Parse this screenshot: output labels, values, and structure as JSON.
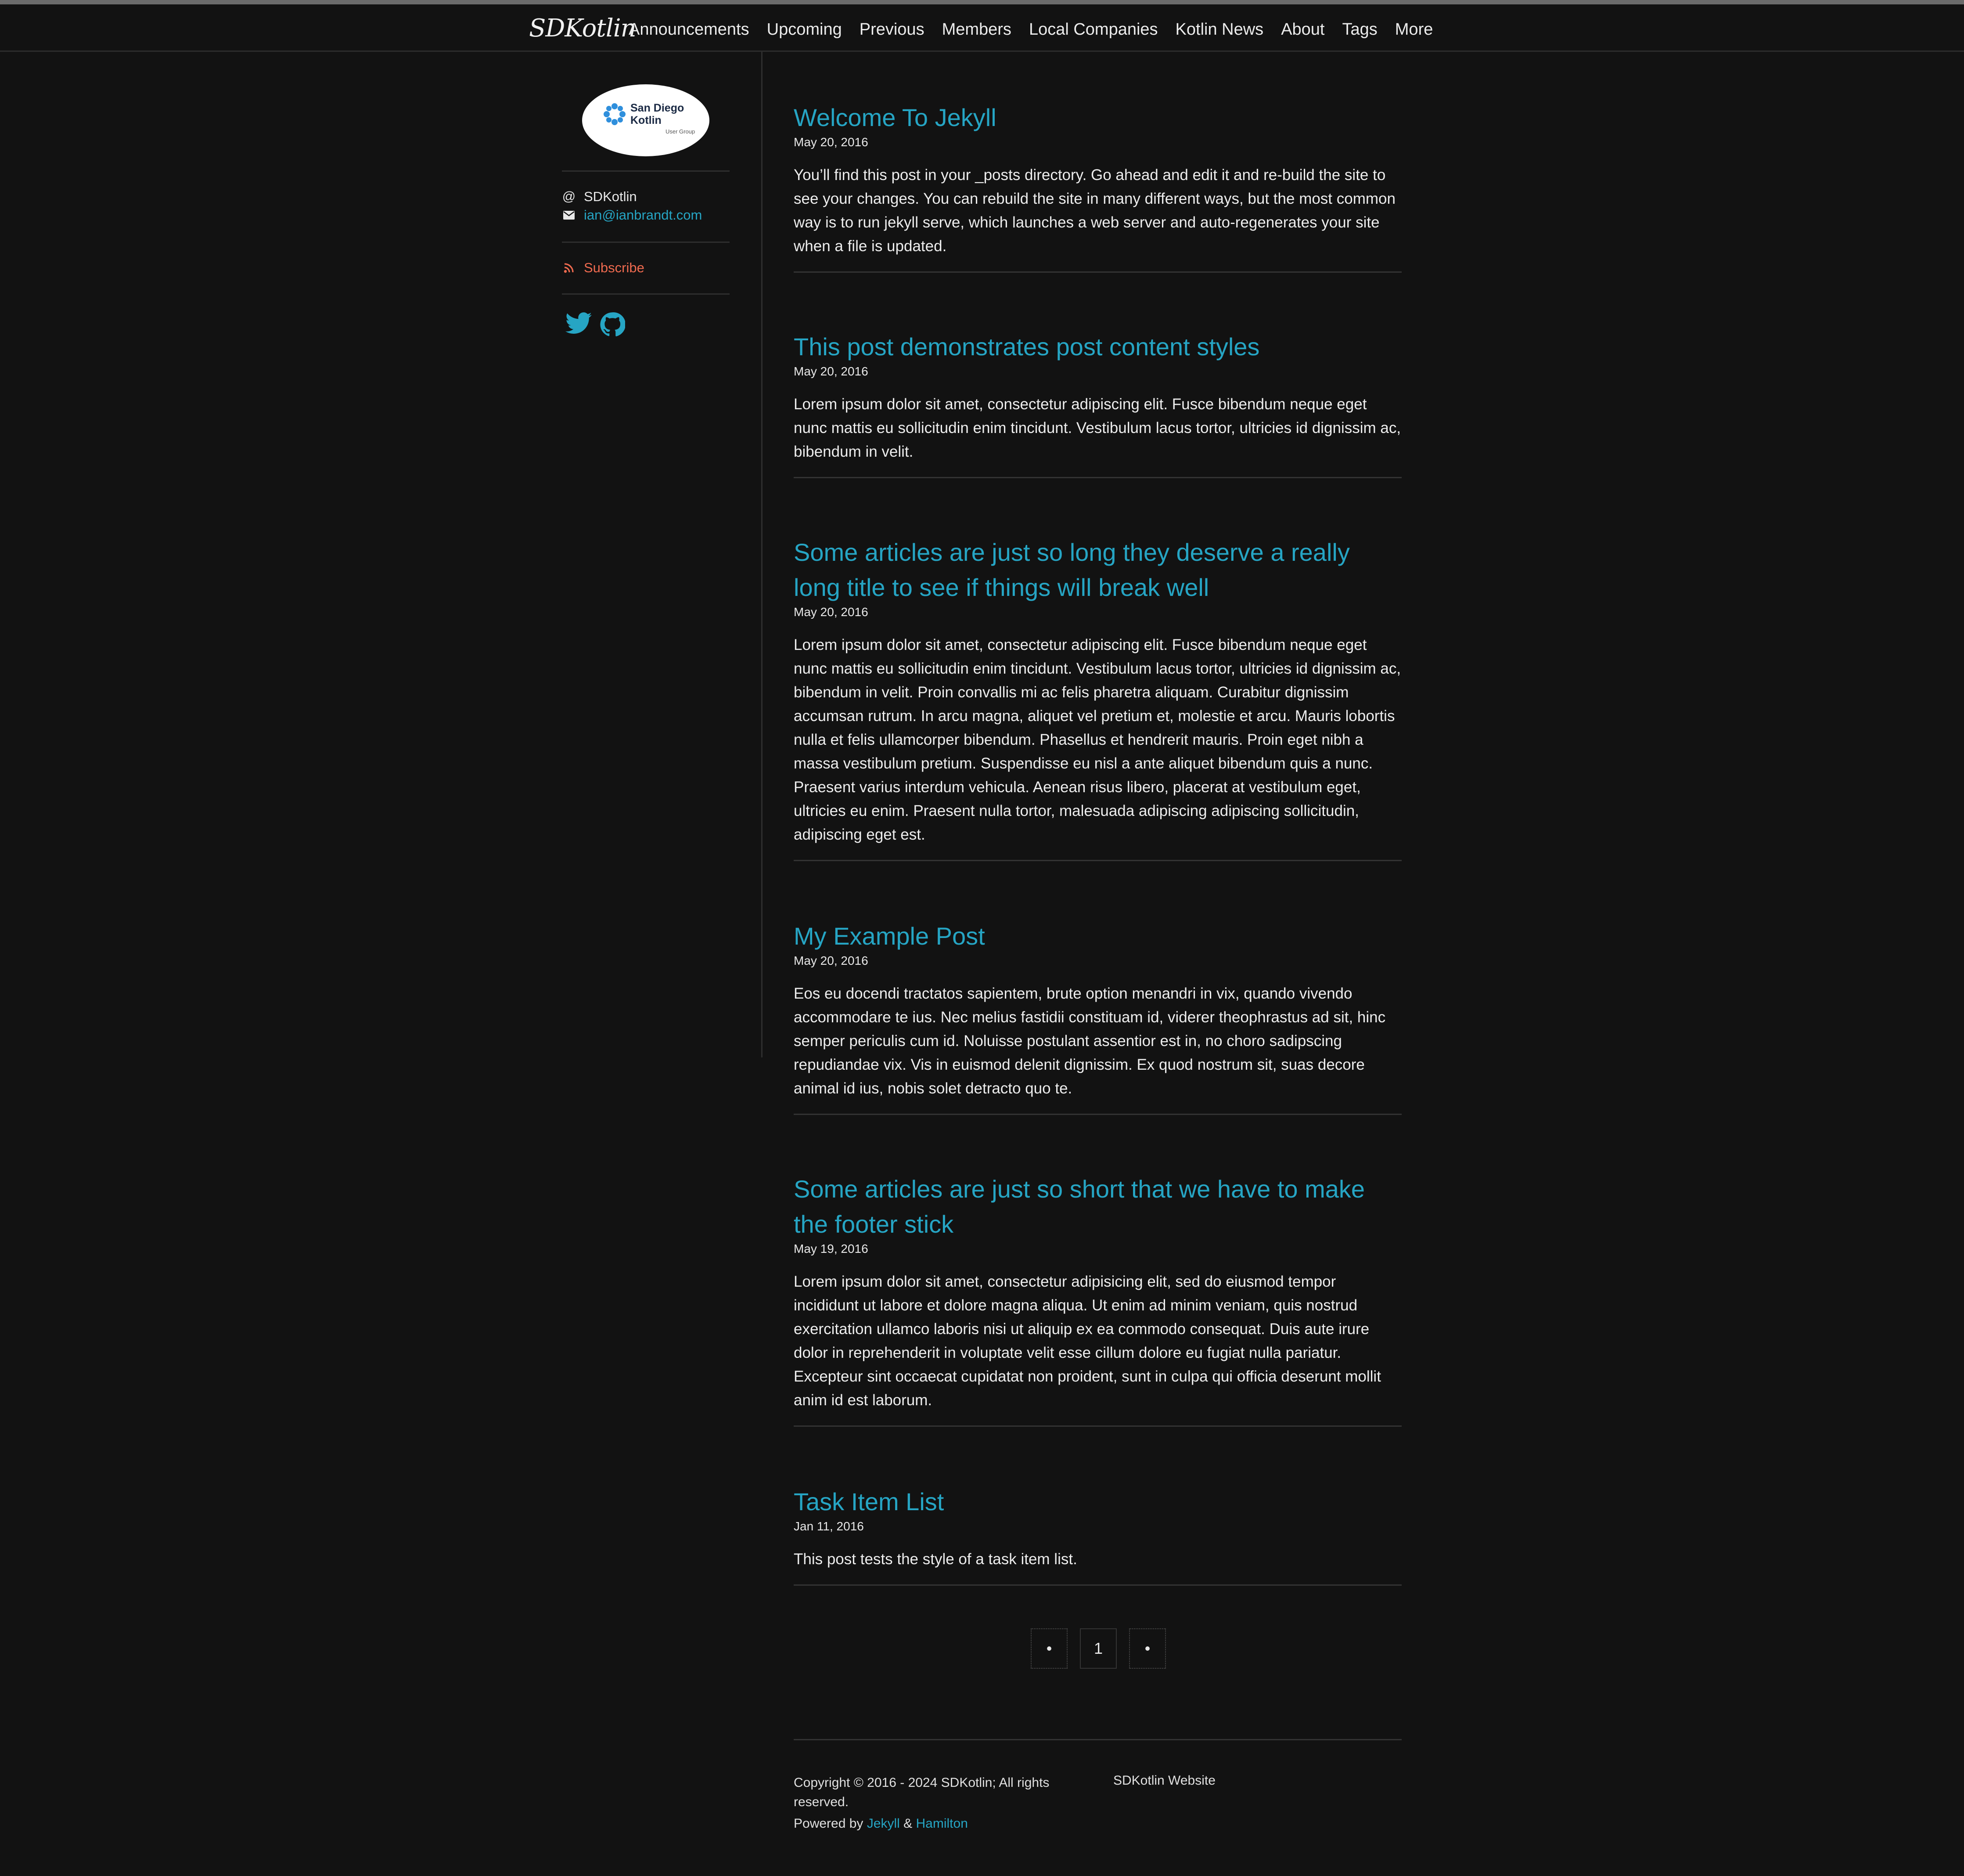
{
  "header": {
    "brand": "SDKotlin",
    "nav": [
      "Announcements",
      "Upcoming",
      "Previous",
      "Members",
      "Local Companies",
      "Kotlin News",
      "About",
      "Tags",
      "More"
    ]
  },
  "sidebar": {
    "logo": {
      "line1": "San Diego",
      "line2": "Kotlin",
      "line3": "User Group"
    },
    "handle": "SDKotlin",
    "email": "ian@ianbrandt.com",
    "subscribe": "Subscribe",
    "social_icons": [
      "twitter-icon",
      "github-icon"
    ]
  },
  "posts": [
    {
      "title": "Welcome To Jekyll",
      "date": "May 20, 2016",
      "excerpt": "You’ll find this post in your _posts directory. Go ahead and edit it and re-build the site to see your changes. You can rebuild the site in many different ways, but the most common way is to run jekyll serve, which launches a web server and auto-regenerates your site when a file is updated."
    },
    {
      "title": "This post demonstrates post content styles",
      "date": "May 20, 2016",
      "excerpt": "Lorem ipsum dolor sit amet, consectetur adipiscing elit. Fusce bibendum neque eget nunc mattis eu sollicitudin enim tincidunt. Vestibulum lacus tortor, ultricies id dignissim ac, bibendum in velit."
    },
    {
      "title": "Some articles are just so long they deserve a really long title to see if things will break well",
      "date": "May 20, 2016",
      "excerpt": "Lorem ipsum dolor sit amet, consectetur adipiscing elit. Fusce bibendum neque eget nunc mattis eu sollicitudin enim tincidunt. Vestibulum lacus tortor, ultricies id dignissim ac, bibendum in velit. Proin convallis mi ac felis pharetra aliquam. Curabitur dignissim accumsan rutrum. In arcu magna, aliquet vel pretium et, molestie et arcu. Mauris lobortis nulla et felis ullamcorper bibendum. Phasellus et hendrerit mauris. Proin eget nibh a massa vestibulum pretium. Suspendisse eu nisl a ante aliquet bibendum quis a nunc. Praesent varius interdum vehicula. Aenean risus libero, placerat at vestibulum eget, ultricies eu enim. Praesent nulla tortor, malesuada adipiscing adipiscing sollicitudin, adipiscing eget est."
    },
    {
      "title": "My Example Post",
      "date": "May 20, 2016",
      "excerpt": "Eos eu docendi tractatos sapientem, brute option menandri in vix, quando vivendo accommodare te ius. Nec melius fastidii constituam id, viderer theophrastus ad sit, hinc semper periculis cum id. Noluisse postulant assentior est in, no choro sadipscing repudiandae vix. Vis in euismod delenit dignissim. Ex quod nostrum sit, suas decore animal id ius, nobis solet detracto quo te."
    },
    {
      "title": "Some articles are just so short that we have to make the footer stick",
      "date": "May 19, 2016",
      "excerpt": "Lorem ipsum dolor sit amet, consectetur adipisicing elit, sed do eiusmod tempor incididunt ut labore et dolore magna aliqua. Ut enim ad minim veniam, quis nostrud exercitation ullamco laboris nisi ut aliquip ex ea commodo consequat. Duis aute irure dolor in reprehenderit in voluptate velit esse cillum dolore eu fugiat nulla pariatur. Excepteur sint occaecat cupidatat non proident, sunt in culpa qui officia deserunt mollit anim id est laborum."
    },
    {
      "title": "Task Item List",
      "date": "Jan 11, 2016",
      "excerpt": "This post tests the style of a task item list."
    }
  ],
  "pagination": {
    "prev": "•",
    "current": "1",
    "next": "•"
  },
  "footer": {
    "copyright": "Copyright © 2016 - 2024 SDKotlin; All rights reserved.",
    "site": "SDKotlin Website",
    "powered_prefix": "Powered by",
    "jekyll": "Jekyll",
    "amp": "&",
    "hamilton": "Hamilton"
  },
  "colors": {
    "background": "#121212",
    "accent": "#26a5c4",
    "subscribe": "#ef6a4f"
  }
}
